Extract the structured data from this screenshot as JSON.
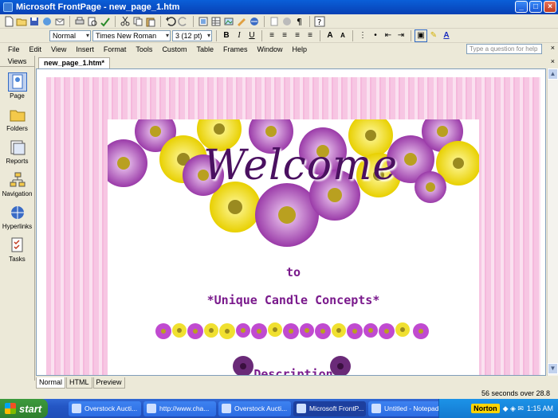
{
  "window": {
    "title": "Microsoft FrontPage - new_page_1.htm"
  },
  "format_bar": {
    "style": "Normal",
    "font": "Times New Roman",
    "size": "3 (12 pt)"
  },
  "menu": [
    "File",
    "Edit",
    "View",
    "Insert",
    "Format",
    "Tools",
    "Custom",
    "Table",
    "Frames",
    "Window",
    "Help"
  ],
  "help_box": {
    "placeholder": "Type a question for help"
  },
  "views_panel": {
    "header": "Views",
    "items": [
      {
        "label": "Page",
        "icon": "page-icon"
      },
      {
        "label": "Folders",
        "icon": "folder-icon"
      },
      {
        "label": "Reports",
        "icon": "reports-icon"
      },
      {
        "label": "Navigation",
        "icon": "navigation-icon"
      },
      {
        "label": "Hyperlinks",
        "icon": "hyperlinks-icon"
      },
      {
        "label": "Tasks",
        "icon": "tasks-icon"
      }
    ]
  },
  "document_tab": "new_page_1.htm*",
  "page": {
    "welcome": "Welcome",
    "to": "to",
    "company": "*Unique Candle Concepts*",
    "description": "Description"
  },
  "view_tabs": [
    "Normal",
    "HTML",
    "Preview"
  ],
  "status": "56 seconds over 28.8",
  "taskbar": {
    "start": "start",
    "tasks": [
      "Overstock Aucti...",
      "http://www.cha...",
      "Overstock Aucti...",
      "Microsoft FrontP...",
      "Untitled - Notepad"
    ],
    "norton": "Norton",
    "clock": "1:15 AM"
  }
}
